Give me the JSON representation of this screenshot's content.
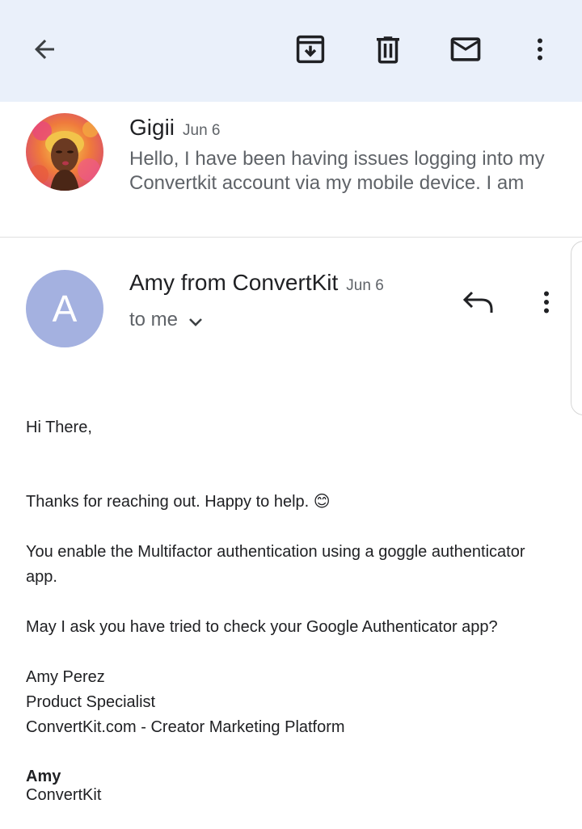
{
  "toolbar": {
    "back_icon": "arrow-back-icon",
    "archive_icon": "archive-icon",
    "delete_icon": "trash-icon",
    "mark_unread_icon": "mail-icon",
    "more_icon": "more-vert-icon"
  },
  "previous_message": {
    "sender": "Gigii",
    "date": "Jun 6",
    "snippet": "Hello, I have been having issues logging into my Convertkit account via my mobile device. I am"
  },
  "current_message": {
    "avatar_letter": "A",
    "sender": "Amy from ConvertKit",
    "date": "Jun 6",
    "recipient": "to me",
    "avatar_color": "#a4b1e0"
  },
  "body": {
    "greeting": "Hi There,",
    "line1": "Thanks for reaching out. Happy to help. 😊",
    "line2": "You enable the Multifactor authentication using a goggle authenticator app.",
    "line3": "May I ask you have tried to check your Google Authenticator app?",
    "sig_name": "Amy Perez",
    "sig_title": "Product Specialist",
    "sig_company": "ConvertKit.com - Creator Marketing Platform",
    "sig2_name": "Amy",
    "sig2_company": "ConvertKit"
  },
  "colors": {
    "toolbar_bg": "#eaf0fa",
    "icon": "#3c4043",
    "secondary_text": "#5f6368"
  }
}
